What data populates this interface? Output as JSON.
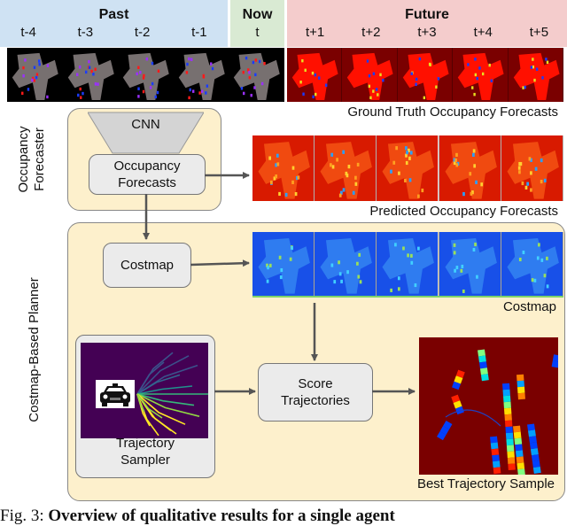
{
  "header": {
    "past": {
      "title": "Past",
      "steps": [
        "t-4",
        "t-3",
        "t-2",
        "t-1"
      ],
      "color": "#cfe2f3"
    },
    "now": {
      "title": "Now",
      "steps": [
        "t"
      ],
      "color": "#d9ead3"
    },
    "future": {
      "title": "Future",
      "steps": [
        "t+1",
        "t+2",
        "t+3",
        "t+4",
        "t+5"
      ],
      "color": "#f4cccc"
    }
  },
  "rows": {
    "ground_truth_caption": "Ground Truth Occupancy Forecasts",
    "predicted_caption": "Predicted Occupancy Forecasts",
    "costmap_caption": "Costmap",
    "best_trajectory_caption": "Best Trajectory Sample"
  },
  "occupancy_forecaster": {
    "label": "Occupancy Forecaster",
    "label_lines": [
      "Occupancy",
      "Forecaster"
    ],
    "cnn_label": "CNN",
    "forecasts_box": [
      "Occupancy",
      "Forecasts"
    ]
  },
  "planner": {
    "label": "Costmap-Based Planner",
    "costmap_box": "Costmap",
    "sampler_box": [
      "Trajectory",
      "Sampler"
    ],
    "score_box": [
      "Score",
      "Trajectories"
    ]
  },
  "icons": {
    "car": "car-front-icon"
  },
  "colors": {
    "panel_fill": "#fdf0cc",
    "box_fill": "#ebebeb",
    "arrow": "#555555",
    "occupancy_red": "#ff0000",
    "occupancy_dark": "#7a0000",
    "costmap_blue": "#1f6fe0",
    "viridis_bg": "#440154"
  },
  "figure_caption": {
    "prefix": "Fig. 3: ",
    "bold": "Overview of qualitative results for a single agent"
  }
}
